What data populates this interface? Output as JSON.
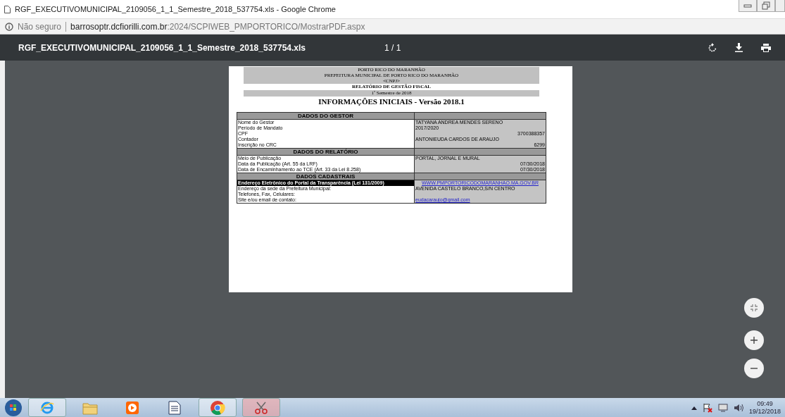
{
  "window": {
    "title": "RGF_EXECUTIVOMUNICIPAL_2109056_1_1_Semestre_2018_537754.xls - Google Chrome"
  },
  "address_bar": {
    "security": "Não seguro",
    "url_host": "barrosoptr.dcfiorilli.com.br",
    "url_path": ":2024/SCPIWEB_PMPORTORICO/MostrarPDF.aspx"
  },
  "pdf_toolbar": {
    "file_name": "RGF_EXECUTIVOMUNICIPAL_2109056_1_1_Semestre_2018_537754.xls",
    "page_count": "1 / 1"
  },
  "document": {
    "header_lines": [
      "PORTO RICO DO MARANHÃO",
      "PREFEITURA MUNICIPAL DE PORTO RICO DO MARANHÃO",
      "<CNPJ>"
    ],
    "report_title": "RELATÓRIO DE GESTÃO FISCAL",
    "period": "1º Semestre de 2018",
    "main_title": "INFORMAÇÕES INICIAIS - Versão 2018.1",
    "rows": [
      {
        "kind": "section",
        "label": "DADOS DO GESTOR"
      },
      {
        "kind": "text",
        "label": "Nome do Gestor",
        "value": "TATYANA ANDREA MENDES SERENO"
      },
      {
        "kind": "text",
        "label": "Período de Mandato",
        "value": "2017/2020"
      },
      {
        "kind": "number",
        "label": "CPF",
        "value": "3700388357"
      },
      {
        "kind": "text",
        "label": "Contador",
        "value": "ANTONIEUDA CARDOS DE ARAUJO"
      },
      {
        "kind": "number",
        "label": "Inscrição no CRC",
        "value": "6299"
      },
      {
        "kind": "section",
        "label": "DADOS DO RELATÓRIO"
      },
      {
        "kind": "text",
        "label": "Meio de Publicação",
        "value": "PORTAL, JORNAL E MURAL"
      },
      {
        "kind": "number",
        "label": "Data da Publicação",
        "note": "(Art. 55 da LRF)",
        "value": "07/30/2018"
      },
      {
        "kind": "number",
        "label": "Data de Encaminhamento ao TCE",
        "note": "(Art. 33 da Lei 8.258)",
        "value": "07/30/2018"
      },
      {
        "kind": "section",
        "label": "DADOS CADASTRAIS"
      },
      {
        "kind": "highlight",
        "label": "Endereço Eletrônico do Portal da Transparência (Lei 131/2009)",
        "value": "WWW.PMPORTORICODOMARANHAO.MA.GOV.BR"
      },
      {
        "kind": "text",
        "label": "Endereço da sede da Prefeitura Municipal:",
        "value": "AVENIDA CASTELO BRANCO,S/N CENTRO"
      },
      {
        "kind": "text",
        "label": "Telefones, Fax, Celulares:"
      },
      {
        "kind": "link",
        "label": "Site e/ou email de contato:",
        "value": "eudacaraujo@gmail.com"
      }
    ]
  },
  "taskbar": {
    "time": "09:49",
    "date": "19/12/2018"
  }
}
